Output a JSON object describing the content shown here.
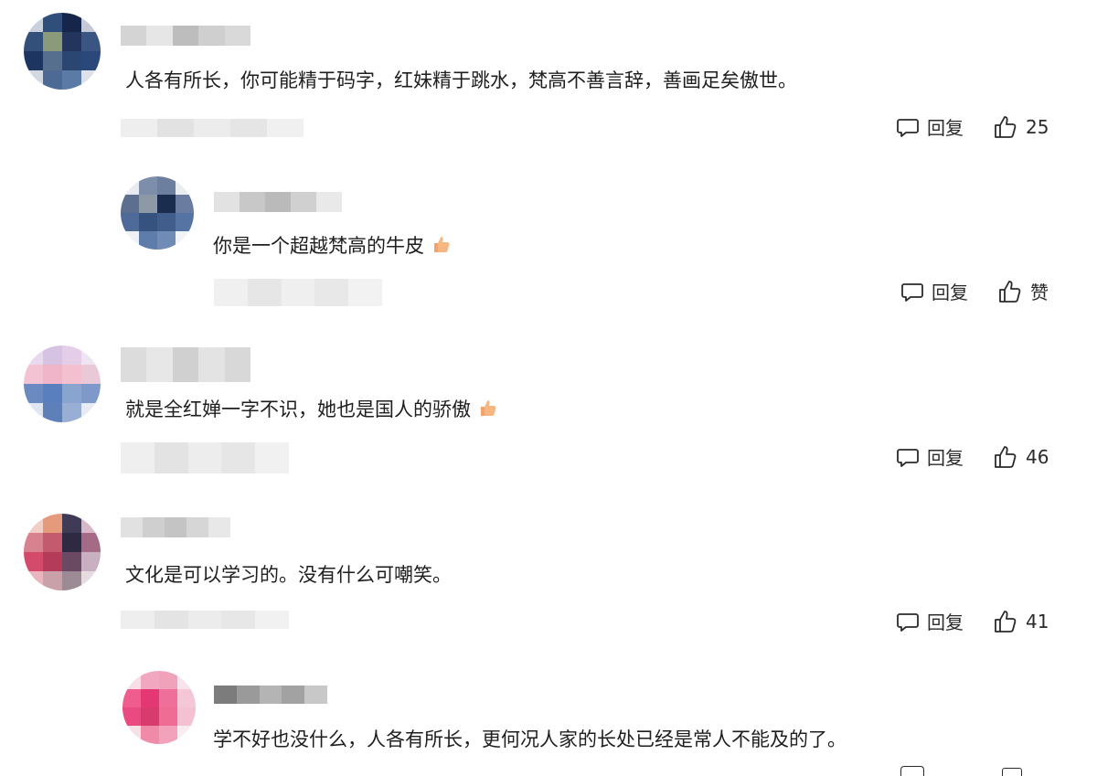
{
  "comments": [
    {
      "text": "人各有所长，你可能精于码字，红妹精于跳水，梵高不善言辞，善画足矣傲世。",
      "reply_label": "回复",
      "like_label": "25"
    },
    {
      "text": "你是一个超越梵高的牛皮",
      "reply_label": "回复",
      "like_label": "赞"
    },
    {
      "text": "就是全红婵一字不识，她也是国人的骄傲",
      "reply_label": "回复",
      "like_label": "46"
    },
    {
      "text": "文化是可以学习的。没有什么可嘲笑。",
      "reply_label": "回复",
      "like_label": "41"
    },
    {
      "text": "学不好也没什么，人各有所长，更何况人家的长处已经是常人不能及的了。"
    }
  ],
  "icons": {
    "reply": "comment-bubble-icon",
    "like": "thumbs-up-icon",
    "emoji": "thumbs-up-emoji-icon"
  },
  "colors": {
    "text": "#1e1e1e",
    "action_text": "#2a2a2a",
    "emoji": "#f3a36b"
  }
}
